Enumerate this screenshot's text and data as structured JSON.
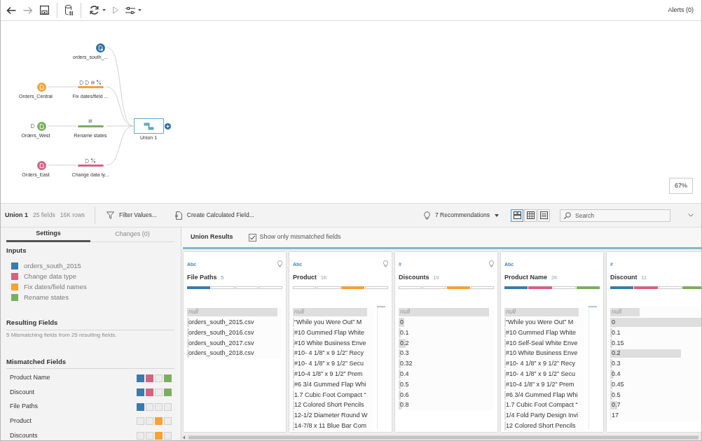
{
  "toolbar": {
    "groups": [
      [
        {
          "kind": "back",
          "disabled": false,
          "has_menu": false
        },
        {
          "kind": "forward",
          "disabled": true,
          "has_menu": false
        },
        {
          "kind": "save",
          "disabled": false,
          "has_menu": false
        }
      ],
      [
        {
          "kind": "pause-data",
          "disabled": false,
          "has_menu": false
        }
      ],
      [
        {
          "kind": "refresh",
          "disabled": false,
          "has_menu": true
        },
        {
          "kind": "run",
          "disabled": true,
          "has_menu": false
        },
        {
          "kind": "options",
          "disabled": false,
          "has_menu": true
        }
      ]
    ],
    "alerts": "Alerts (0)"
  },
  "flow": {
    "branches": [
      {
        "nodes": [
          {
            "kind": "input-union",
            "label": "orders_south_...",
            "color": "#2f6f9f"
          }
        ]
      },
      {
        "nodes": [
          {
            "kind": "input",
            "label": "Orders_Central",
            "color": "#f7a033"
          },
          {
            "kind": "clean",
            "label": "Fix dates/field ...",
            "color": "#f7a033",
            "changes": [
              {
                "kind": "tag"
              },
              {
                "kind": "tag"
              },
              {
                "kind": "hash"
              },
              {
                "kind": "percent"
              }
            ]
          }
        ]
      },
      {
        "nodes": [
          {
            "kind": "input",
            "label": "Orders_West",
            "color": "#7cae61",
            "changes": [
              {
                "kind": "tag"
              }
            ]
          },
          {
            "kind": "clean",
            "label": "Rename states",
            "color": "#7cae61",
            "changes": [
              {
                "kind": "hash"
              }
            ]
          }
        ]
      },
      {
        "nodes": [
          {
            "kind": "input",
            "label": "Orders_East",
            "color": "#d4637f"
          },
          {
            "kind": "clean",
            "label": "Change data ty...",
            "color": "#d4637f",
            "changes": [
              {
                "kind": "tag"
              },
              {
                "kind": "percent"
              }
            ]
          }
        ]
      }
    ],
    "union": {
      "label": "Union 1",
      "selected": true
    },
    "zoom": "67%"
  },
  "profile_toolbar": {
    "title": "Union 1",
    "fields": "25 fields",
    "rows": "16K rows",
    "actions": [
      {
        "kind": "filter",
        "label": "Filter Values..."
      },
      {
        "kind": "calculated",
        "label": "Create Calculated Field..."
      }
    ],
    "recommendations": "7 Recommendations",
    "views": [
      {
        "kind": "cards",
        "selected": true
      },
      {
        "kind": "table",
        "selected": false
      },
      {
        "kind": "list",
        "selected": false
      }
    ],
    "search": {
      "placeholder": "Search"
    }
  },
  "settings": {
    "tabs": [
      {
        "label": "Settings",
        "selected": true
      },
      {
        "label": "Changes (0)",
        "selected": false
      }
    ],
    "inputs": {
      "heading": "Inputs",
      "items": [
        {
          "label": "orders_south_2015",
          "color": "#3a7bab"
        },
        {
          "label": "Change data type",
          "color": "#d4637f"
        },
        {
          "label": "Fix dates/field names",
          "color": "#f7a136"
        },
        {
          "label": "Rename states",
          "color": "#7cae61"
        }
      ]
    },
    "resulting_fields": {
      "heading": "Resulting Fields",
      "summary": "5 Mismatching fields from 25 resulting fields."
    },
    "mismatched_fields": {
      "heading": "Mismatched Fields",
      "items": [
        {
          "name": "Product Name",
          "sources": [
            true,
            true,
            false,
            true
          ]
        },
        {
          "name": "Discount",
          "sources": [
            true,
            true,
            false,
            true
          ]
        },
        {
          "name": "File Paths",
          "sources": [
            true,
            false,
            false,
            false
          ]
        },
        {
          "name": "Product",
          "sources": [
            false,
            false,
            true,
            false
          ]
        },
        {
          "name": "Discounts",
          "sources": [
            false,
            false,
            true,
            false
          ]
        }
      ]
    }
  },
  "results": {
    "title": "Union Results",
    "filter": {
      "label": "Show only mismatched fields",
      "checked": true
    },
    "cards": [
      {
        "type": "Abc",
        "name": "File Paths",
        "count": "5",
        "recommendation": true,
        "sources": [
          true,
          false,
          false,
          false
        ],
        "values": [
          {
            "kind": "null",
            "text": "null",
            "level": 0.95
          },
          {
            "kind": "value",
            "text": "orders_south_2015.csv",
            "level": 0.02
          },
          {
            "kind": "value",
            "text": "orders_south_2016.csv",
            "level": 0.02
          },
          {
            "kind": "value",
            "text": "orders_south_2017.csv",
            "level": 0.02
          },
          {
            "kind": "value",
            "text": "orders_south_2018.csv",
            "level": 0.02
          }
        ]
      },
      {
        "type": "Abc",
        "name": "Product",
        "count": "1K",
        "recommendation": true,
        "sources": [
          false,
          false,
          true,
          false
        ],
        "values": [
          {
            "kind": "null",
            "text": "null",
            "level": 0.93
          },
          {
            "kind": "value",
            "text": "“While you Were Out” M",
            "level": 0.02
          },
          {
            "kind": "value",
            "text": "#10 Gummed Flap White",
            "level": 0.02
          },
          {
            "kind": "value",
            "text": "#10 White Business Enve",
            "level": 0.02
          },
          {
            "kind": "value",
            "text": "#10- 4 1/8” x 9 1/2” Recy",
            "level": 0.02
          },
          {
            "kind": "value",
            "text": "#10- 4 1/8” x 9 1/2” Secu",
            "level": 0.02
          },
          {
            "kind": "value",
            "text": "#10-4 1/8” x 9 1/2” Prem",
            "level": 0.02
          },
          {
            "kind": "value",
            "text": "#6 3/4 Gummed Flap Whi",
            "level": 0.02
          },
          {
            "kind": "value",
            "text": "1.7 Cubic Foot Compact “",
            "level": 0.02
          },
          {
            "kind": "value",
            "text": "12 Colored Short Pencils",
            "level": 0.02
          },
          {
            "kind": "value",
            "text": "12-1/2 Diameter Round W",
            "level": 0.02
          },
          {
            "kind": "value",
            "text": "14-7/8 x 11 Blue Bar Com",
            "level": 0.02
          }
        ]
      },
      {
        "type": "#",
        "name": "Discounts",
        "count": "10",
        "recommendation": true,
        "sources": [
          false,
          false,
          true,
          false
        ],
        "values": [
          {
            "kind": "null",
            "text": "null",
            "level": 0.95
          },
          {
            "kind": "value",
            "text": "0",
            "level": 0.06
          },
          {
            "kind": "value",
            "text": "0.1",
            "level": 0.02
          },
          {
            "kind": "value",
            "text": "0.2",
            "level": 0.07
          },
          {
            "kind": "value",
            "text": "0.3",
            "level": 0.02
          },
          {
            "kind": "value",
            "text": "0.32",
            "level": 0.02
          },
          {
            "kind": "value",
            "text": "0.4",
            "level": 0.02
          },
          {
            "kind": "value",
            "text": "0.5",
            "level": 0.02
          },
          {
            "kind": "value",
            "text": "0.6",
            "level": 0.02
          },
          {
            "kind": "value",
            "text": "0.8",
            "level": 0.03
          }
        ]
      },
      {
        "type": "Abc",
        "name": "Product Name",
        "count": "2K",
        "recommendation": false,
        "sources": [
          true,
          true,
          false,
          true
        ],
        "values": [
          {
            "kind": "null",
            "text": "null",
            "level": 0.93
          },
          {
            "kind": "value",
            "text": "“While you Were Out” M",
            "level": 0.02
          },
          {
            "kind": "value",
            "text": "#10 Gummed Flap White",
            "level": 0.02
          },
          {
            "kind": "value",
            "text": "#10 Self-Seal White Enve",
            "level": 0.02
          },
          {
            "kind": "value",
            "text": "#10 White Business Enve",
            "level": 0.02
          },
          {
            "kind": "value",
            "text": "#10- 4 1/8” x 9 1/2” Recy",
            "level": 0.02
          },
          {
            "kind": "value",
            "text": "#10- 4 1/8” x 9 1/2” Secu",
            "level": 0.02
          },
          {
            "kind": "value",
            "text": "#10-4 1/8” x 9 1/2” Prem",
            "level": 0.02
          },
          {
            "kind": "value",
            "text": "#6 3/4 Gummed Flap Whi",
            "level": 0.02
          },
          {
            "kind": "value",
            "text": "1.7 Cubic Foot Compact “",
            "level": 0.02
          },
          {
            "kind": "value",
            "text": "1/4 Fold Party Design Invi",
            "level": 0.02
          },
          {
            "kind": "value",
            "text": "12 Colored Short Pencils",
            "level": 0.02
          }
        ]
      },
      {
        "type": "#",
        "name": "Discount",
        "count": "11",
        "recommendation": false,
        "sources": [
          true,
          true,
          false,
          true
        ],
        "values": [
          {
            "kind": "null",
            "text": "null",
            "level": 0.31
          },
          {
            "kind": "value",
            "text": "0",
            "level": 1
          },
          {
            "kind": "value",
            "text": "0.1",
            "level": 0.02
          },
          {
            "kind": "value",
            "text": "0.15",
            "level": 0.02
          },
          {
            "kind": "value",
            "text": "0.2",
            "level": 0.74
          },
          {
            "kind": "value",
            "text": "0.3",
            "level": 0.02
          },
          {
            "kind": "value",
            "text": "0.4",
            "level": 0.04
          },
          {
            "kind": "value",
            "text": "0.45",
            "level": 0.02
          },
          {
            "kind": "value",
            "text": "0.5",
            "level": 0.02
          },
          {
            "kind": "value",
            "text": "0.7",
            "level": 0.07
          },
          {
            "kind": "value",
            "text": "17",
            "level": 0.01
          }
        ]
      }
    ]
  }
}
